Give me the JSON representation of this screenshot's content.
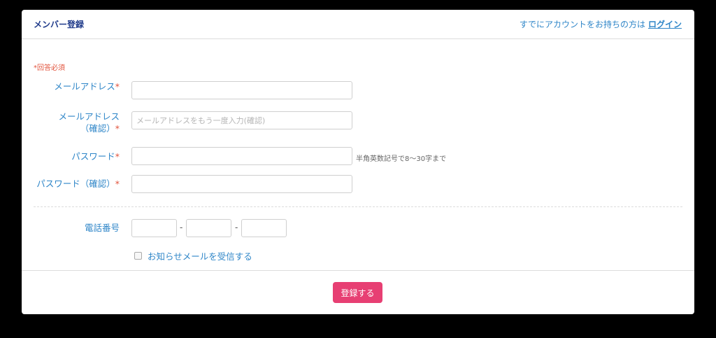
{
  "header": {
    "title": "メンバー登録",
    "login_prompt": "すでにアカウントをお持ちの方は",
    "login_link": "ログイン"
  },
  "form": {
    "required_note": "*回答必須",
    "required_mark": "*",
    "email_label": "メールアドレス",
    "email_value": "",
    "email_confirm_label_line1": "メールアドレス",
    "email_confirm_label_line2": "（確認）",
    "email_confirm_placeholder": "メールアドレスをもう一度入力(確認)",
    "password_label": "パスワード",
    "password_hint": "半角英数記号で8～30字まで",
    "password_confirm_label": "パスワード（確認）",
    "phone_label": "電話番号",
    "phone_separator": "-",
    "newsletter_label": "お知らせメールを受信する",
    "newsletter_checked": false
  },
  "footer": {
    "submit_label": "登録する"
  },
  "colors": {
    "accent": "#2f86c8",
    "title": "#1f3a8a",
    "required": "#e2533c",
    "submit": "#e73f73"
  }
}
